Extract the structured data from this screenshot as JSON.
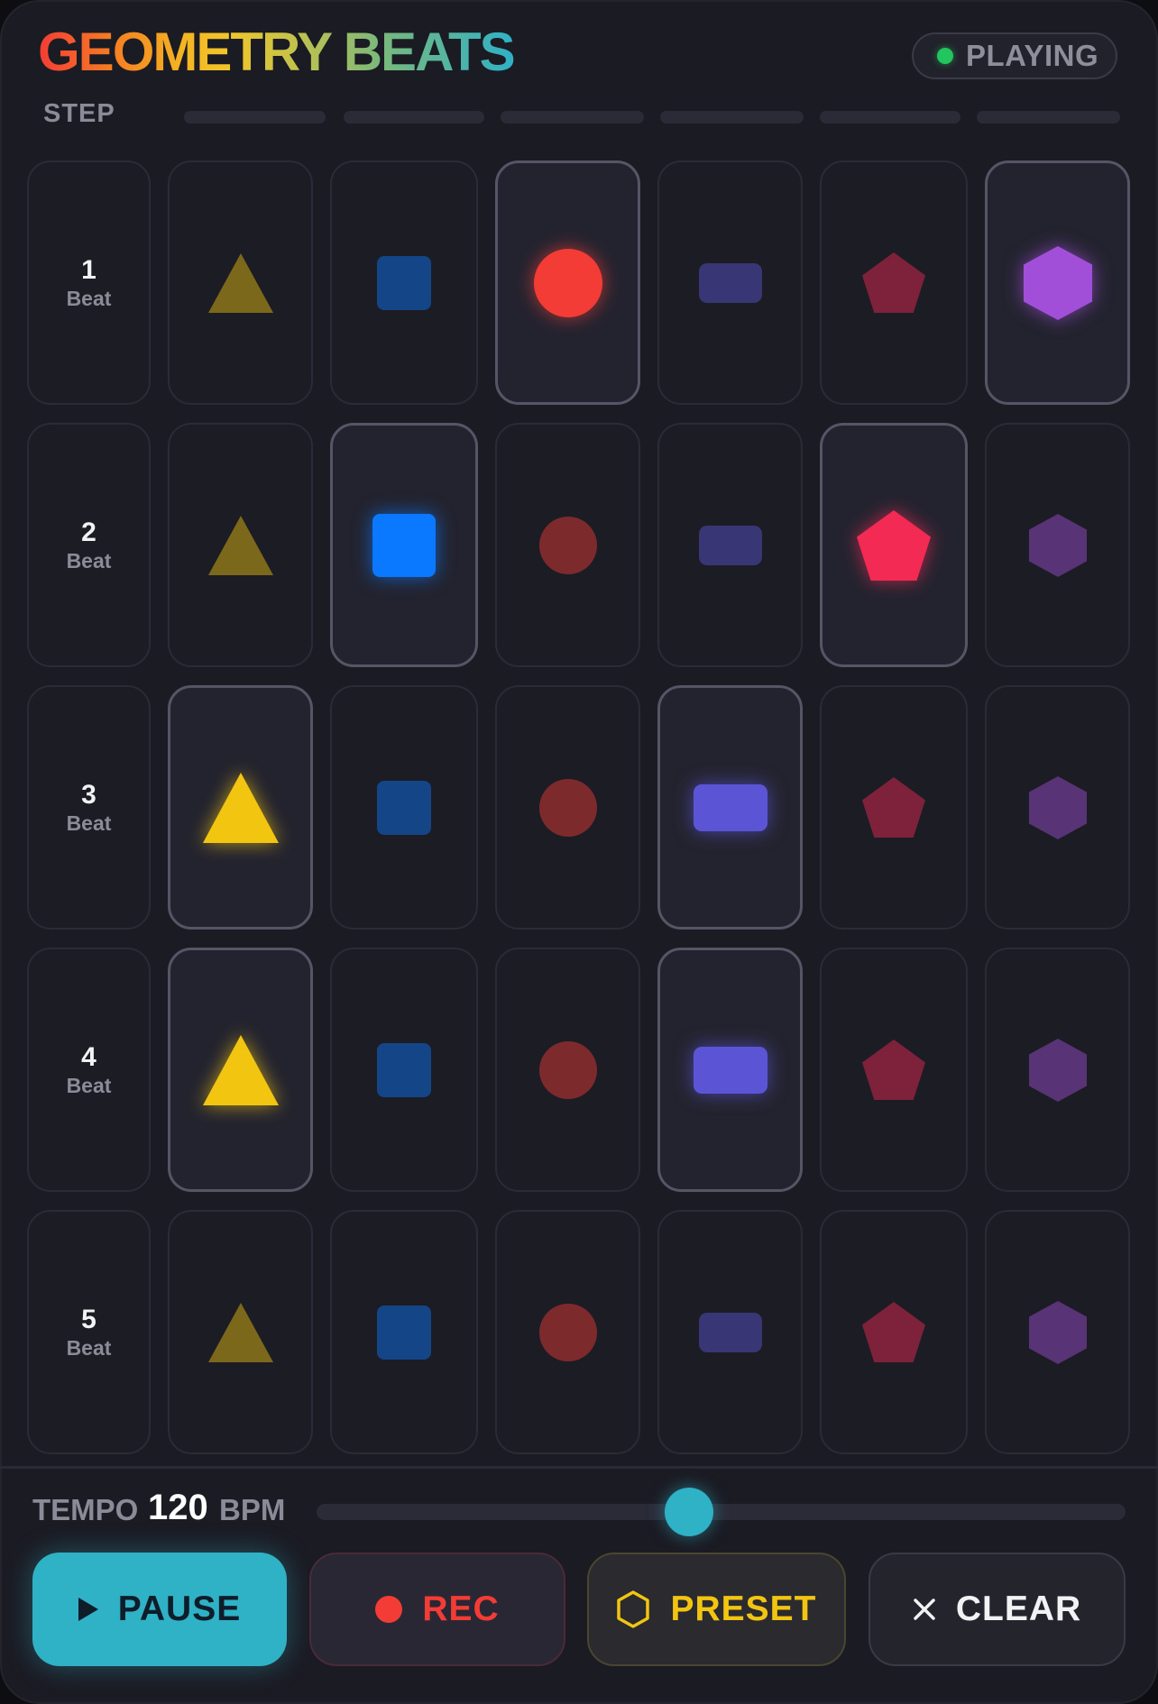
{
  "app": {
    "title": "GEOMETRY BEATS",
    "status": "PLAYING",
    "step_label": "STEP"
  },
  "grid": {
    "beat_word": "Beat",
    "columns": [
      {
        "shape": "triangle",
        "color": "#f2c511"
      },
      {
        "shape": "square",
        "color": "#0a78ff"
      },
      {
        "shape": "circle",
        "color": "#f33c35"
      },
      {
        "shape": "rounded-rect",
        "color": "#5b55d6"
      },
      {
        "shape": "pentagon",
        "color": "#f32a54"
      },
      {
        "shape": "hexagon",
        "color": "#a14fd9"
      }
    ],
    "rows": [
      {
        "beat": "1",
        "active": [
          false,
          false,
          true,
          false,
          false,
          true
        ]
      },
      {
        "beat": "2",
        "active": [
          false,
          true,
          false,
          false,
          true,
          false
        ]
      },
      {
        "beat": "3",
        "active": [
          true,
          false,
          false,
          true,
          false,
          false
        ]
      },
      {
        "beat": "4",
        "active": [
          true,
          false,
          false,
          true,
          false,
          false
        ]
      },
      {
        "beat": "5",
        "active": [
          false,
          false,
          false,
          false,
          false,
          false
        ]
      }
    ]
  },
  "tempo": {
    "label": "TEMPO",
    "value": "120",
    "unit": "BPM",
    "slider_fraction": 0.46
  },
  "buttons": {
    "pause": {
      "label": "PAUSE",
      "icon": "play-icon"
    },
    "rec": {
      "label": "REC",
      "icon": "record-dot-icon"
    },
    "preset": {
      "label": "PRESET",
      "icon": "hexagon-outline-icon"
    },
    "clear": {
      "label": "CLEAR",
      "icon": "close-icon"
    }
  }
}
